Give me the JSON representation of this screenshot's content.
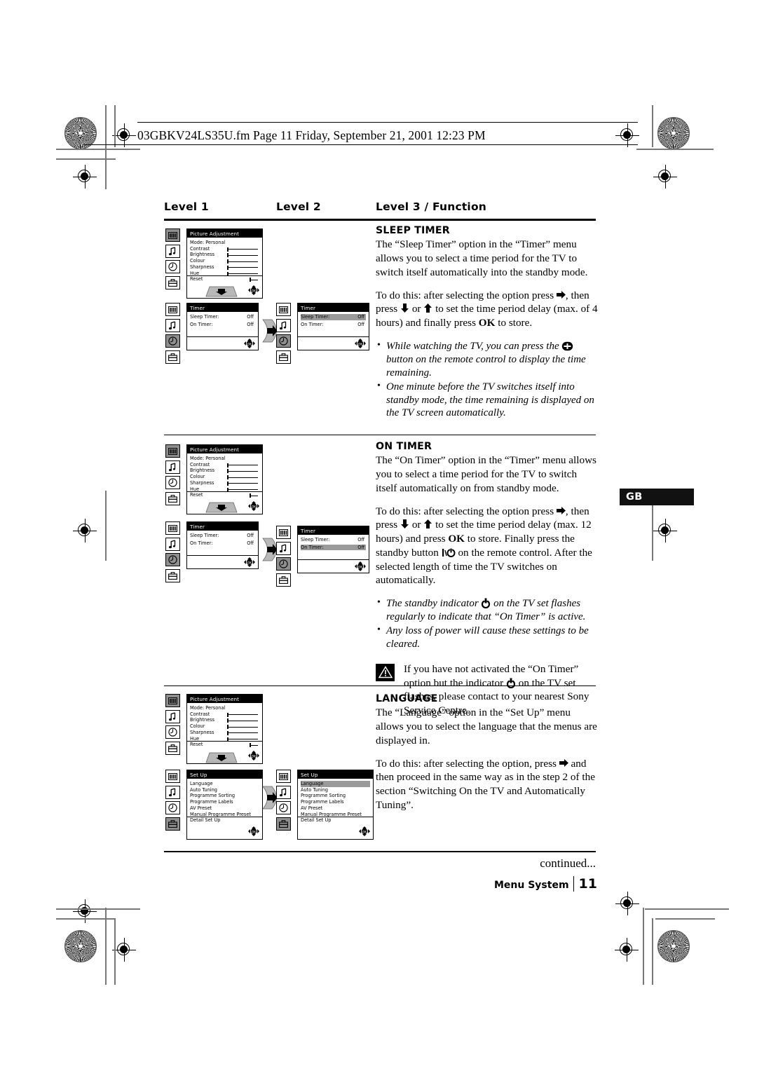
{
  "header": {
    "filename_line": "03GBKV24LS35U.fm  Page 11  Friday, September 21, 2001  12:23 PM"
  },
  "columns": {
    "level1": "Level  1",
    "level2": "Level  2",
    "level3": "Level 3 / Function"
  },
  "language_tab": "GB",
  "sections": [
    {
      "id": "sleep-timer",
      "heading": "SLEEP TIMER",
      "paragraph1": "The “Sleep Timer” option in the “Timer” menu allows you to select a time period for the TV to switch itself automatically into the standby mode.",
      "para2_a": "To do this: after selecting the option press",
      "para2_b": ", then press",
      "para2_c": "or",
      "para2_d": "to set the time period delay (max. of 4 hours) and finally press",
      "para2_ok": "OK",
      "para2_e": "to store.",
      "bullets": [
        {
          "a": "While watching the TV, you can press the",
          "icon": "plus-box-icon",
          "b": "button on the remote control to display the time remaining."
        },
        {
          "a": "One minute before the TV switches itself into standby mode, the time remaining is displayed on the TV screen automatically.",
          "icon": "",
          "b": ""
        }
      ]
    },
    {
      "id": "on-timer",
      "heading": "ON TIMER",
      "paragraph1": "The “On Timer” option in the “Timer” menu allows you to select a time period for the TV to switch itself automatically on from standby mode.",
      "para2_a": "To do this: after selecting the option press",
      "para2_b": ", then press",
      "para2_c": "or",
      "para2_d": "to set the time period delay (max. 12 hours) and press",
      "para2_ok": "OK",
      "para2_e": "to store. Finally press the standby button",
      "para2_f": "on the remote control. After the selected length of time the TV switches on automatically.",
      "bullets": [
        {
          "a": "The standby indicator",
          "icon": "power-icon",
          "b": "on the TV set flashes regularly to indicate that “On Timer” is active."
        },
        {
          "a": "Any loss of power will cause these settings to be cleared.",
          "icon": "",
          "b": ""
        }
      ],
      "warning": {
        "a": "If you have not activated the “On Timer” option but the indicator",
        "icon": "power-icon",
        "b": "on the TV set flashes, please contact to your nearest Sony Service Centre."
      }
    },
    {
      "id": "language",
      "heading": "LANGUAGE",
      "paragraph1": "The “Language” option in the “Set Up” menu allows you to select the language that the menus are displayed in.",
      "para2_a": "To do this: after selecting the option, press",
      "para2_b": "and then proceed in the same way as in the step 2 of the section “Switching On the TV and Automatically Tuning”."
    }
  ],
  "osd": {
    "picture_adjustment": {
      "title": "Picture Adjustment",
      "mode_label": "Mode:  Personal",
      "rows": [
        "Contrast",
        "Brightness",
        "Colour",
        "Sharpness",
        "Hue",
        "Reset"
      ]
    },
    "timer": {
      "title": "Timer",
      "rows": [
        {
          "label": "Sleep Timer:",
          "value": "Off"
        },
        {
          "label": "On Timer:",
          "value": "Off"
        }
      ]
    },
    "setup": {
      "title": "Set Up",
      "rows": [
        "Language",
        "Auto Tuning",
        "Programme Sorting",
        "Programme Labels",
        "AV Preset",
        "Manual Programme Preset",
        "Detail Set Up"
      ]
    },
    "side_icons": [
      "picture-icon",
      "sound-icon",
      "timer-icon",
      "setup-icon"
    ],
    "ok_label": "OK"
  },
  "footer": {
    "continued": "continued...",
    "section": "Menu System",
    "page_number": "11"
  }
}
